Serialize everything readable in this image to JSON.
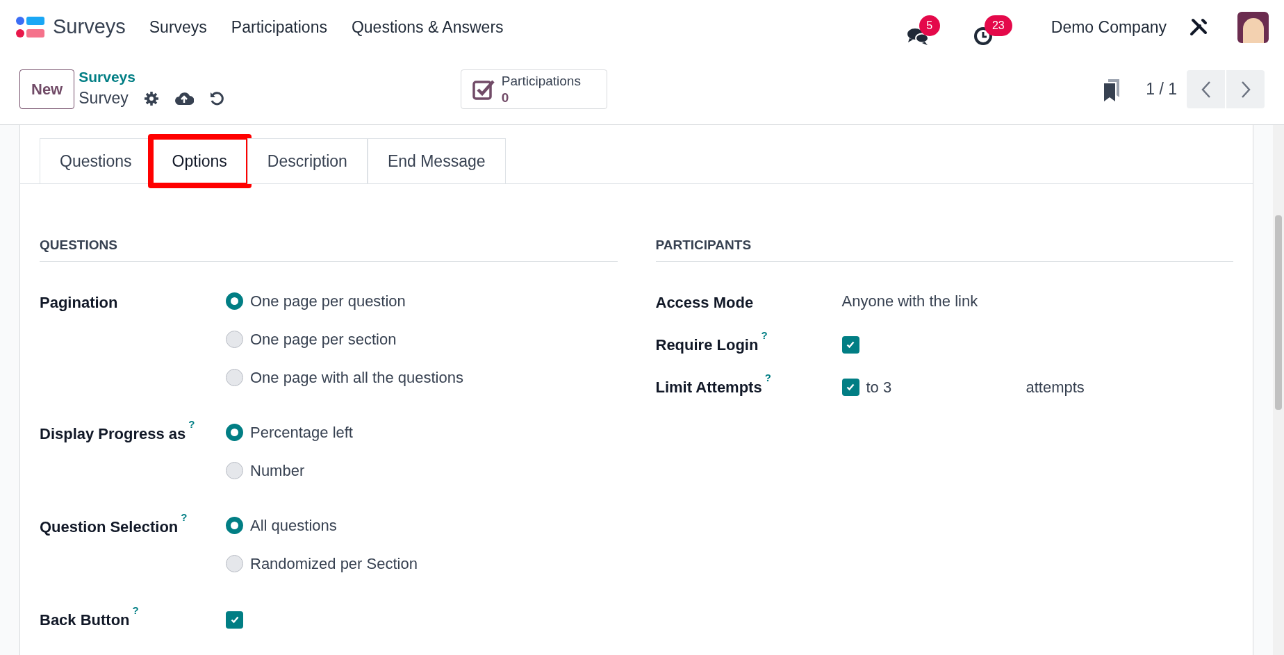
{
  "navbar": {
    "app_name": "Surveys",
    "menu": [
      "Surveys",
      "Participations",
      "Questions & Answers"
    ],
    "messages_count": "5",
    "activities_count": "23",
    "company": "Demo Company"
  },
  "control_panel": {
    "new_button": "New",
    "breadcrumb": "Surveys",
    "record": "Survey",
    "stat_button": {
      "label": "Participations",
      "value": "0"
    },
    "pager": "1 / 1"
  },
  "tabs": [
    {
      "label": "Questions",
      "selected": false,
      "highlighted": false
    },
    {
      "label": "Options",
      "selected": true,
      "highlighted": true
    },
    {
      "label": "Description",
      "selected": false,
      "highlighted": false
    },
    {
      "label": "End Message",
      "selected": false,
      "highlighted": false
    }
  ],
  "questions_section": {
    "title": "QUESTIONS",
    "fields": [
      {
        "label": "Pagination",
        "kind": "radio",
        "options": [
          {
            "label": "One page per question",
            "selected": true
          },
          {
            "label": "One page per section",
            "selected": false
          },
          {
            "label": "One page with all the questions",
            "selected": false
          }
        ]
      },
      {
        "label": "Display Progress as",
        "help": "?",
        "kind": "radio",
        "options": [
          {
            "label": "Percentage left",
            "selected": true
          },
          {
            "label": "Number",
            "selected": false
          }
        ]
      },
      {
        "label": "Question Selection",
        "help": "?",
        "kind": "radio",
        "options": [
          {
            "label": "All questions",
            "selected": true
          },
          {
            "label": "Randomized per Section",
            "selected": false
          }
        ]
      },
      {
        "label": "Back Button",
        "help": "?",
        "kind": "checkbox",
        "checked": true
      }
    ]
  },
  "participants_section": {
    "title": "PARTICIPANTS",
    "fields": [
      {
        "label": "Access Mode",
        "kind": "text",
        "value": "Anyone with the link"
      },
      {
        "label": "Require Login",
        "help": "?",
        "kind": "checkbox",
        "checked": true
      },
      {
        "label": "Limit Attempts",
        "help": "?",
        "kind": "limit",
        "checked": true,
        "value": "to 3",
        "suffix": "attempts"
      }
    ]
  }
}
